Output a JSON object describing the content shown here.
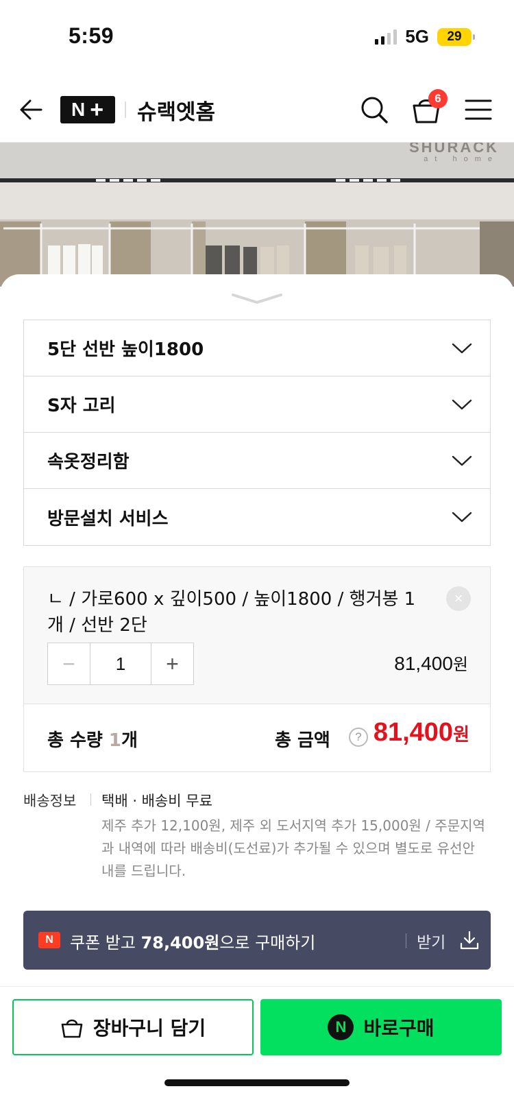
{
  "status_bar": {
    "time": "5:59",
    "network": "5G",
    "battery": "29"
  },
  "header": {
    "logo_n": "N",
    "logo_plus": "+",
    "store_name": "슈랙엣홈",
    "cart_count": "6"
  },
  "product_image": {
    "brand": "SHURACK",
    "brand_sub": "at home"
  },
  "options": [
    {
      "label": "5단 선반 높이1800"
    },
    {
      "label": "S자 고리"
    },
    {
      "label": "속옷정리함"
    },
    {
      "label": "방문설치 서비스"
    }
  ],
  "selected_item": {
    "description": "ㄴ / 가로600 x 깊이500 / 높이1800 / 행거봉 1개 / 선반 2단",
    "remove": "×",
    "minus": "−",
    "quantity": "1",
    "plus": "+",
    "price": "81,400",
    "price_unit": "원"
  },
  "total": {
    "qty_label": "총 수량 ",
    "qty_value": "1",
    "qty_unit": "개",
    "amount_label": "총 금액",
    "help": "?",
    "amount": "81,400",
    "amount_unit": "원"
  },
  "shipping": {
    "label": "배송정보",
    "main": "택배 · 배송비 무료",
    "desc": "제주 추가 12,100원, 제주 외 도서지역 추가 15,000원 / 주문지역과 내역에 따라 배송비(도선료)가 추가될 수 있으며 별도로 유선안내를 드립니다."
  },
  "coupon": {
    "badge": "N",
    "prefix": "쿠폰 받고 ",
    "price": "78,400원",
    "suffix": "으로 구매하기",
    "get_label": "받기"
  },
  "actions": {
    "cart_label": "장바구니 담기",
    "buy_icon": "N",
    "buy_label": "바로구매"
  },
  "colors": {
    "accent_green": "#03c75a",
    "price_red": "#e1131c",
    "coupon_bg": "#474a63"
  }
}
